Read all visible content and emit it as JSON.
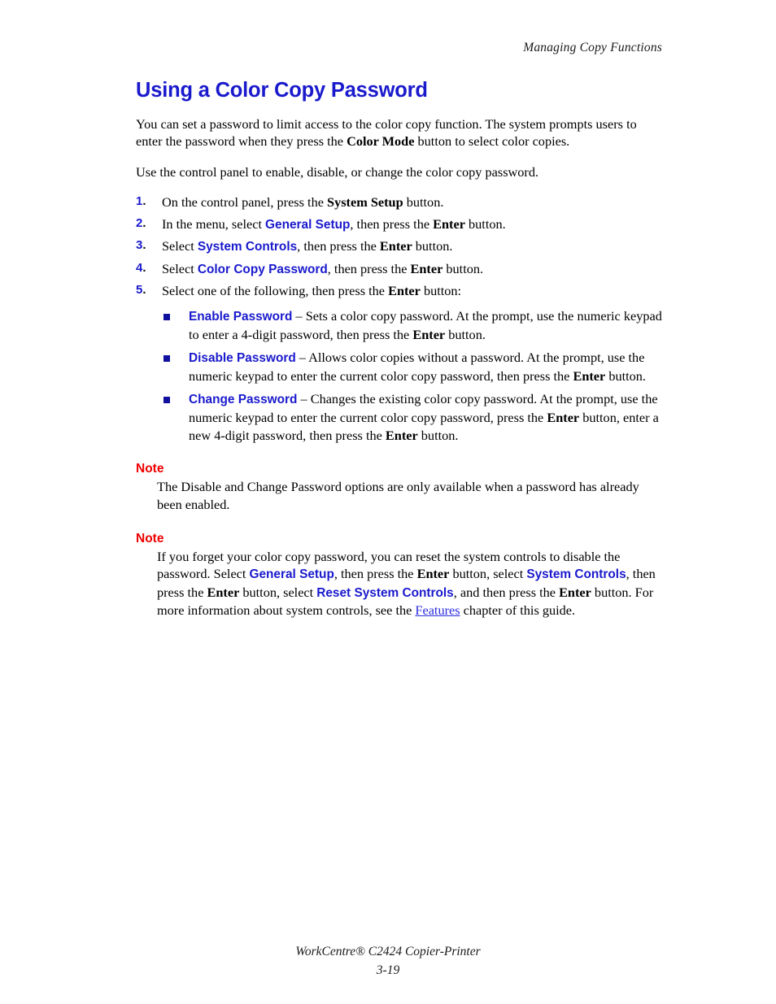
{
  "header": {
    "running_head": "Managing Copy Functions"
  },
  "section": {
    "title": "Using a Color Copy Password",
    "intro_1_a": "You can set a password to limit access to the color copy function. The system prompts users to enter the password when they press the ",
    "intro_1_b": "Color Mode",
    "intro_1_c": " button to select color copies.",
    "intro_2": "Use the control panel to enable, disable, or change the color copy password."
  },
  "steps": [
    {
      "num": "1.",
      "a": "On the control panel, press the ",
      "b": "System Setup",
      "b_style": "bold",
      "c": " button."
    },
    {
      "num": "2.",
      "a": "In the menu, select ",
      "b": "General Setup",
      "b_style": "blue",
      "c": ", then press the ",
      "d": "Enter",
      "e": " button."
    },
    {
      "num": "3.",
      "a": "Select ",
      "b": "System Controls",
      "b_style": "blue",
      "c": ", then press the ",
      "d": "Enter",
      "e": " button."
    },
    {
      "num": "4.",
      "a": "Select ",
      "b": "Color Copy Password",
      "b_style": "blue",
      "c": ", then press the ",
      "d": "Enter",
      "e": " button."
    },
    {
      "num": "5.",
      "a": "Select one of the following, then press the ",
      "d": "Enter",
      "e": " button:"
    }
  ],
  "bullets": [
    {
      "term": "Enable Password",
      "a": " – Sets a color copy password. At the prompt, use the numeric keypad to enter a 4-digit password, then press the ",
      "b": "Enter",
      "c": " button."
    },
    {
      "term": "Disable Password",
      "a": " – Allows color copies without a password. At the prompt, use the numeric keypad to enter the current color copy password, then press the ",
      "b": "Enter",
      "c": " button."
    },
    {
      "term": "Change Password",
      "a": " – Changes the existing color copy password. At the prompt, use the numeric keypad to enter the current color copy password, press the ",
      "b": "Enter",
      "c": " button, enter a new 4-digit password, then press the ",
      "d": "Enter",
      "e": " button."
    }
  ],
  "note_1": {
    "label": "Note",
    "text": "The Disable and Change Password options are only available when a password has already been enabled."
  },
  "note_2": {
    "label": "Note",
    "t1": "If you forget your color copy password, you can reset the system controls to disable the password. Select ",
    "m1": "General Setup",
    "t2": ", then press the ",
    "b1": "Enter",
    "t3": " button, select ",
    "m2": "System Controls",
    "t4": ", then press the ",
    "b2": "Enter",
    "t5": " button, select ",
    "m3": "Reset System Controls",
    "t6": ", and then press the ",
    "b3": "Enter",
    "t7": " button. For more information about system controls, see the ",
    "link": "Features",
    "t8": " chapter of this guide."
  },
  "footer": {
    "product": "WorkCentre® C2424 Copier-Printer",
    "page_number": "3-19"
  },
  "colors": {
    "heading_blue": "#1a1acd",
    "menu_blue": "#1a1acd",
    "note_red": "#ef0000",
    "bullet_square": "#10109e",
    "link_blue": "#2b2be0",
    "body_black": "#000000"
  }
}
